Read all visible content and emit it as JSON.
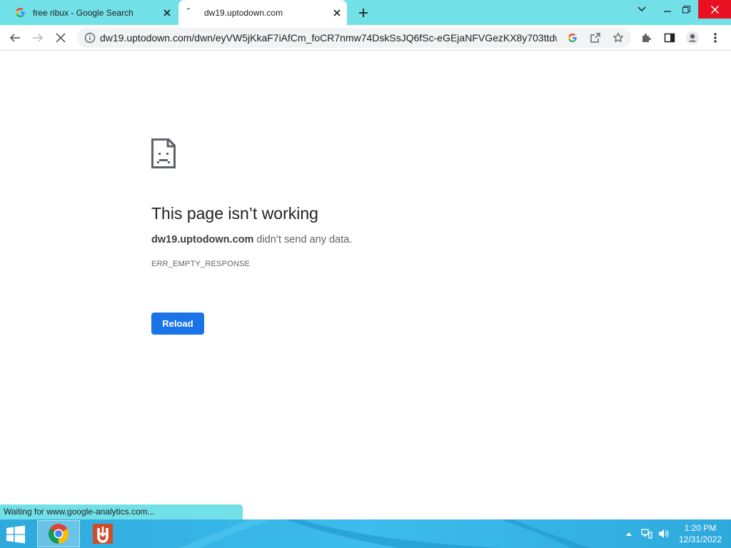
{
  "tabs": [
    {
      "title": "free ribux - Google Search",
      "icon": "google-g-icon",
      "active": false
    },
    {
      "title": "dw19.uptodown.com",
      "icon": "loading-icon",
      "active": true
    }
  ],
  "toolbar": {
    "url": "dw19.uptodown.com/dwn/eyVW5jKkaF7iAfCm_foCR7nmw74DskSsJQ6fSc-eGEjaNFVGezKX8y703ttdw..."
  },
  "error": {
    "title": "This page isn’t working",
    "host": "dw19.uptodown.com",
    "message": " didn’t send any data.",
    "code": "ERR_EMPTY_RESPONSE",
    "reload_label": "Reload"
  },
  "status_text": "Waiting for www.google-analytics.com...",
  "taskbar": {
    "time": "1:20 PM",
    "date": "12/31/2022"
  },
  "colors": {
    "frame": "#71e0e7",
    "accent": "#1a73e8",
    "taskbar": "#2ea9dc",
    "close": "#e81123"
  }
}
